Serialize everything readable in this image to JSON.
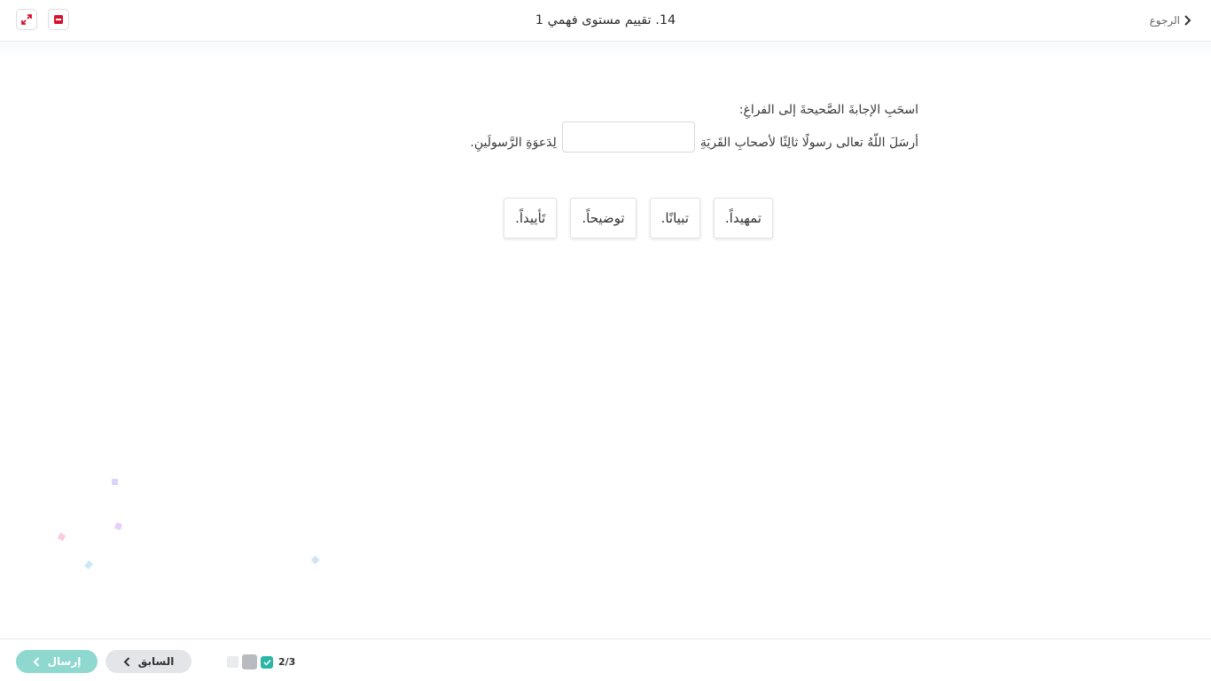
{
  "header": {
    "back_label": "الرجوع",
    "title": "14. تقييم مستوى فهمي 1"
  },
  "question": {
    "instruction": "اسحَبِ الإجابةَ الصَّحيحةَ إلى الفراغِ:",
    "sentence_before": "أرسَلَ اللّهُ تعالى رسولًا ثالِثًا لأصحابِ القَريَةِ",
    "sentence_after": "لِدَعوَةِ الرَّسولَينِ."
  },
  "options": [
    {
      "label": "تَأييداً."
    },
    {
      "label": "توضيحاً."
    },
    {
      "label": "تبيانًا."
    },
    {
      "label": "تمهيداً."
    }
  ],
  "footer": {
    "submit_label": "إرسال",
    "prev_label": "السابق",
    "progress_text": "2/3"
  },
  "colors": {
    "accent": "#2bb5a5",
    "submit_bg": "#8fd8d0",
    "pdf_icon": "#d9122b",
    "expand_icon": "#d9122b"
  },
  "icons": {
    "back": "chevron-right-icon",
    "expand": "expand-arrows-icon",
    "pdf": "pdf-icon",
    "submit": "chevron-left-icon",
    "prev": "chevron-left-icon",
    "check": "check-icon"
  }
}
